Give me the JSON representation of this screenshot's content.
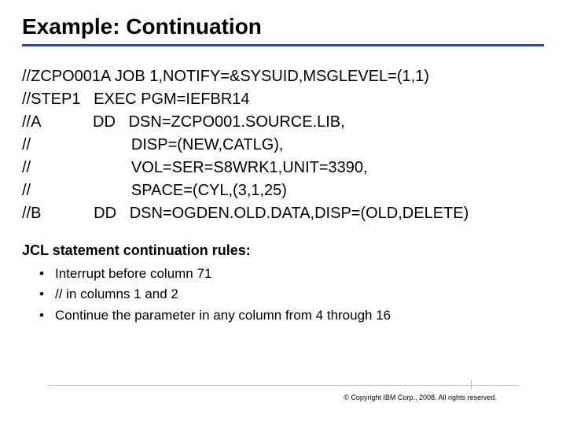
{
  "title": "Example: Continuation",
  "code_lines": [
    "//ZCPO001A JOB 1,NOTIFY=&SYSUID,MSGLEVEL=(1,1)",
    "//STEP1   EXEC PGM=IEFBR14",
    "//A            DD   DSN=ZCPO001.SOURCE.LIB,",
    "//                       DISP=(NEW,CATLG),",
    "//                       VOL=SER=S8WRK1,UNIT=3390,",
    "//                       SPACE=(CYL,(3,1,25)",
    "//B            DD   DSN=OGDEN.OLD.DATA,DISP=(OLD,DELETE)"
  ],
  "rules_heading": "JCL statement continuation rules:",
  "rules": [
    "Interrupt before column 71",
    "// in columns 1 and 2",
    "Continue the parameter in any column from 4 through 16"
  ],
  "copyright": "© Copyright IBM Corp., 2008. All rights reserved."
}
